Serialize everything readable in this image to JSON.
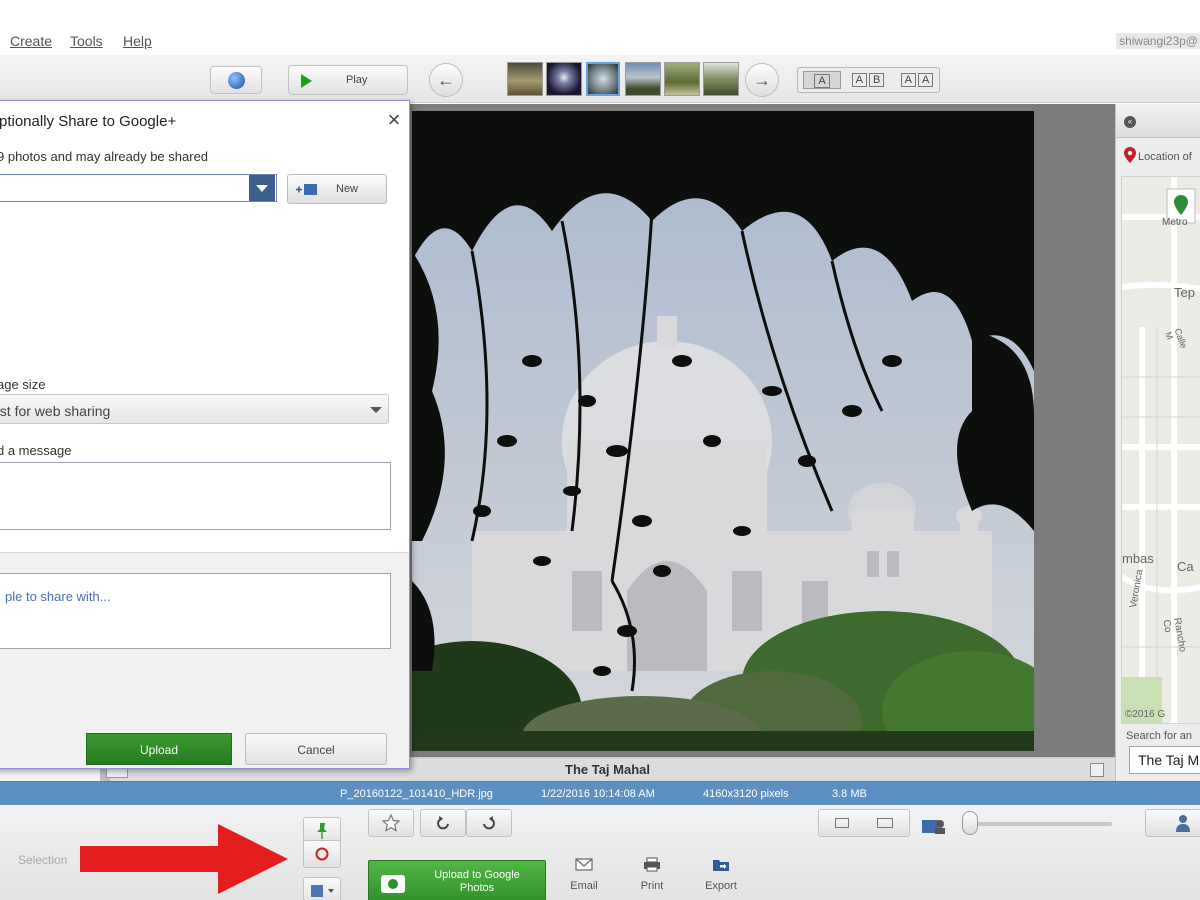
{
  "menu": {
    "items": [
      "Create",
      "Tools",
      "Help"
    ],
    "account_text": "shiwangi23p@"
  },
  "toolbar": {
    "play_label": "Play",
    "layout_options": [
      [
        "A"
      ],
      [
        "A",
        "B"
      ],
      [
        "A",
        "A"
      ]
    ]
  },
  "dialog": {
    "title": "ptionally Share to Google+",
    "album_note": "9 photos and may already be shared",
    "new_album_label": "New",
    "image_size_label": "age size",
    "image_size_value": "est for web sharing",
    "message_label": "d a message",
    "people_placeholder": "ple to share with...",
    "upload_label": "Upload",
    "cancel_label": "Cancel"
  },
  "viewer": {
    "caption": "The Taj Mahal"
  },
  "info": {
    "filename": "P_20160122_101410_HDR.jpg",
    "datetime": "1/22/2016 10:14:08 AM",
    "dimensions": "4160x3120 pixels",
    "filesize": "3.8 MB"
  },
  "places": {
    "location_label": "Location of",
    "map_labels": [
      "Metro",
      "Tep",
      "Calle M",
      "mbas",
      "Ca",
      "Veronica",
      "Rancho Co"
    ],
    "copyright": "©2016 G",
    "search_label": "Search for an",
    "search_value": "The Taj M"
  },
  "tray": {
    "selection_label": "Selection",
    "upload_label_lines": [
      "Upload to Google",
      "Photos"
    ],
    "email_label": "Email",
    "print_label": "Print",
    "export_label": "Export"
  },
  "colors": {
    "info_bar": "#5d8fc3",
    "upload_green": "#2f8f2a",
    "annotation_arrow": "#e41e1e"
  }
}
